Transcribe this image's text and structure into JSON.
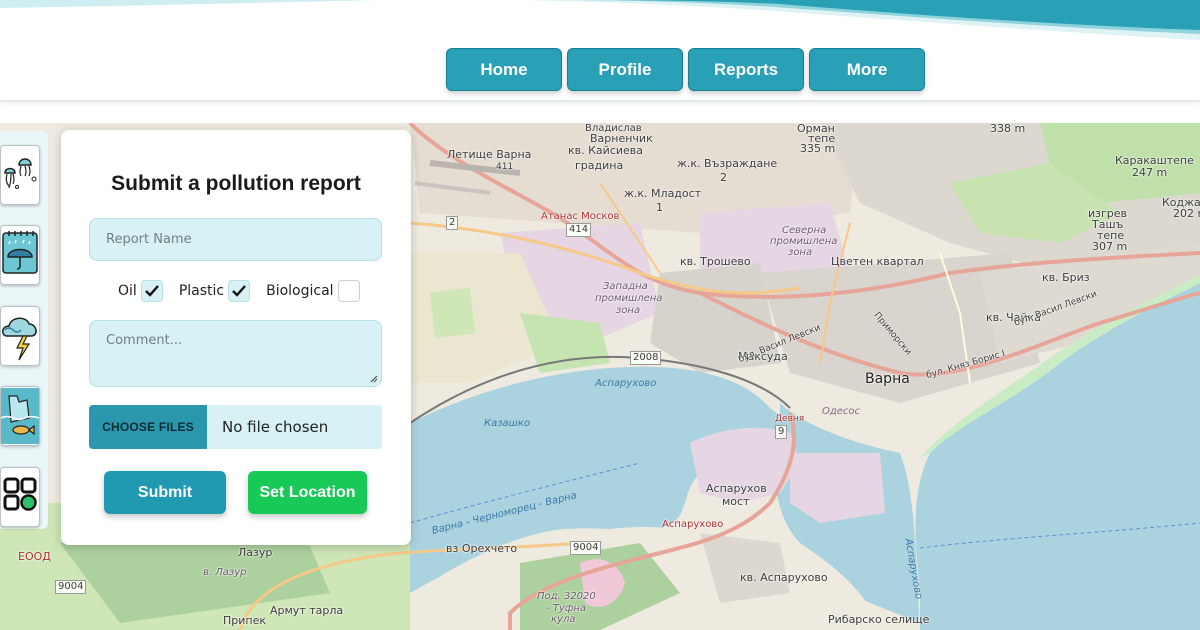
{
  "nav": {
    "items": [
      "Home",
      "Profile",
      "Reports",
      "More"
    ]
  },
  "tools": [
    "jellyfish-icon",
    "rain-umbrella-icon",
    "storm-cloud-icon",
    "plastic-waste-icon",
    "grid-menu-icon"
  ],
  "report_form": {
    "title": "Submit a pollution report",
    "name_placeholder": "Report Name",
    "pollution_types": [
      {
        "label": "Oil",
        "checked": true
      },
      {
        "label": "Plastic",
        "checked": true
      },
      {
        "label": "Biological",
        "checked": false
      }
    ],
    "comment_placeholder": "Comment...",
    "choose_files_label": "CHOOSE FILES",
    "file_status": "No file chosen",
    "submit_label": "Submit",
    "set_location_label": "Set Location"
  },
  "map": {
    "labels": {
      "lazur": "Лазур",
      "v_lazur": "в. Лазур",
      "eood": "ЕООД",
      "armut": "Армут тарла",
      "pripek": "Припек",
      "orehcheto": "вз Орехчето",
      "road9004a": "9004",
      "road9004b": "9004",
      "pad": "Под. 32020",
      "tufna": "- Туфна",
      "kula": "кула",
      "asparuhov_most": "Аспарухов",
      "most": "мост",
      "asparuhovo_road": "Аспарухово",
      "kv_asparuhovo": "кв. Аспарухово",
      "ribarsko": "Рибарско селище",
      "varna": "Варна",
      "odesos": "Одесос",
      "maksuda": "Максуда",
      "kv_troshevo": "кв. Трошево",
      "tsveten": "Цветен квартал",
      "kv_briz": "кв. Бриз",
      "kv_chaika": "кв. Чайка",
      "zapadna1": "Западна",
      "zapadna2": "промишлена",
      "zapadna3": "зона",
      "severna1": "Северна",
      "severna2": "промишлена",
      "severna3": "зона",
      "mladost": "ж.к. Младост",
      "mladost_num": "1",
      "vazrazhdane": "ж.к. Възраждане",
      "vazr_num": "2",
      "kaysieva": "кв. Кайсиева",
      "gradina": "градина",
      "varnenchik": "Варненчик",
      "vladislav": "Владислав",
      "letishte": "Летище Варна",
      "road411": "411",
      "atanas": "Атанас Москов",
      "road414": "414",
      "road2": "2",
      "road2008": "2008",
      "road9": "9",
      "kazashko": "Казашко",
      "asparuhovo_water": "Аспарухово",
      "chernomorsk": "Варна - Черноморец - Варна",
      "karakashtepe": "Каракаштепе",
      "m247": "247 m",
      "kodzhatepe": "Коджа",
      "m202": "202 m",
      "izgrev": "изгрев",
      "tashtepe": "Ташъ",
      "tepe": "тепе",
      "m307": "307 m",
      "orman": "Орман",
      "tepe2": "тепе",
      "m335": "335 m",
      "m338": "338 m",
      "vasil": "бул. Васил Левски",
      "knyaz": "бул. Княз Борис I",
      "vasil2": "бул. Васил Левски",
      "asparuhovo_vert": "Аспарухово",
      "devnya": "Девня",
      "primorski": "Приморски"
    }
  }
}
